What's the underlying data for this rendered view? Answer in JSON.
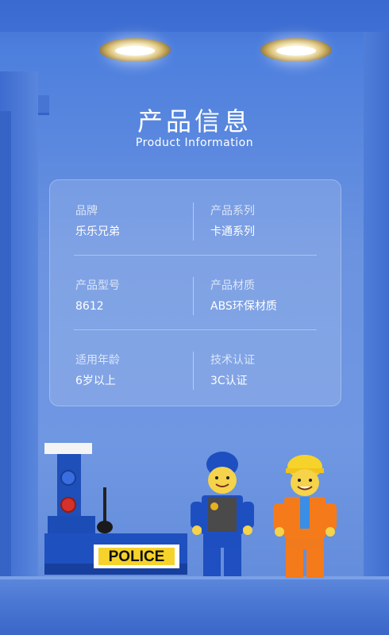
{
  "header": {
    "title": "产品信息",
    "subtitle": "Product Information"
  },
  "info": {
    "rows": [
      {
        "left": {
          "label": "品牌",
          "value": "乐乐兄弟"
        },
        "right": {
          "label": "产品系列",
          "value": "卡通系列"
        }
      },
      {
        "left": {
          "label": "产品型号",
          "value": "8612"
        },
        "right": {
          "label": "产品材质",
          "value": "ABS环保材质"
        }
      },
      {
        "left": {
          "label": "适用年龄",
          "value": "6岁以上"
        },
        "right": {
          "label": "技术认证",
          "value": "3C认证"
        }
      }
    ]
  },
  "scene": {
    "sign_text": "POLICE",
    "accent": "#f6d32b",
    "wall_color": "#6b93e0"
  }
}
